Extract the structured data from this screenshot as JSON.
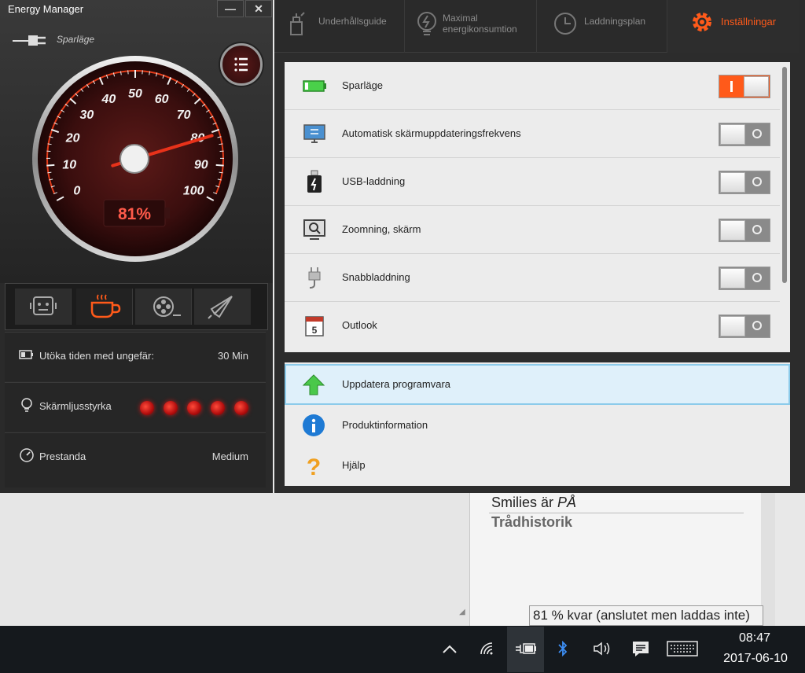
{
  "app": {
    "title": "Energy Manager",
    "minimize": "—",
    "close": "✕",
    "mode_label": "Sparläge"
  },
  "gauge": {
    "ticks": [
      "0",
      "10",
      "20",
      "30",
      "40",
      "50",
      "60",
      "70",
      "80",
      "90",
      "100"
    ],
    "value": 81,
    "readout": "81%"
  },
  "info": {
    "extend_label": "Utöka tiden med ungefär:",
    "extend_value": "30 Min",
    "brightness_label": "Skärmljusstyrka",
    "brightness_level": 5,
    "brightness_max": 5,
    "performance_label": "Prestanda",
    "performance_value": "Medium"
  },
  "nav": [
    {
      "label": "Underhållsguide",
      "icon": "maintenance-icon"
    },
    {
      "label": "Maximal\nenergikonsumtion",
      "icon": "bulb-icon"
    },
    {
      "label": "Laddningsplan",
      "icon": "clock-icon"
    },
    {
      "label": "Inställningar",
      "icon": "gear-icon"
    }
  ],
  "settings": [
    {
      "label": "Sparläge",
      "on": true,
      "icon": "battery-icon"
    },
    {
      "label": "Automatisk skärmuppdateringsfrekvens",
      "on": false,
      "icon": "monitor-icon"
    },
    {
      "label": "USB-laddning",
      "on": false,
      "icon": "usb-charge-icon"
    },
    {
      "label": "Zoomning, skärm",
      "on": false,
      "icon": "zoom-screen-icon"
    },
    {
      "label": "Snabbladdning",
      "on": false,
      "icon": "plug-icon"
    },
    {
      "label": "Outlook",
      "on": false,
      "icon": "calendar-icon"
    }
  ],
  "links": [
    {
      "label": "Uppdatera programvara",
      "icon": "up-arrow-icon"
    },
    {
      "label": "Produktinformation",
      "icon": "info-icon"
    },
    {
      "label": "Hjälp",
      "icon": "question-icon"
    }
  ],
  "web": {
    "smilies_prefix": "Smilies är ",
    "smilies_state": "PÅ",
    "thread_history": "Trådhistorik"
  },
  "tooltip": "81 % kvar (anslutet men laddas inte)",
  "taskbar": {
    "time": "08:47",
    "date": "2017-06-10"
  },
  "colors": {
    "accent": "#ff5a1a",
    "gauge_red": "#e43d1b",
    "readout": "#ff5a4a"
  }
}
